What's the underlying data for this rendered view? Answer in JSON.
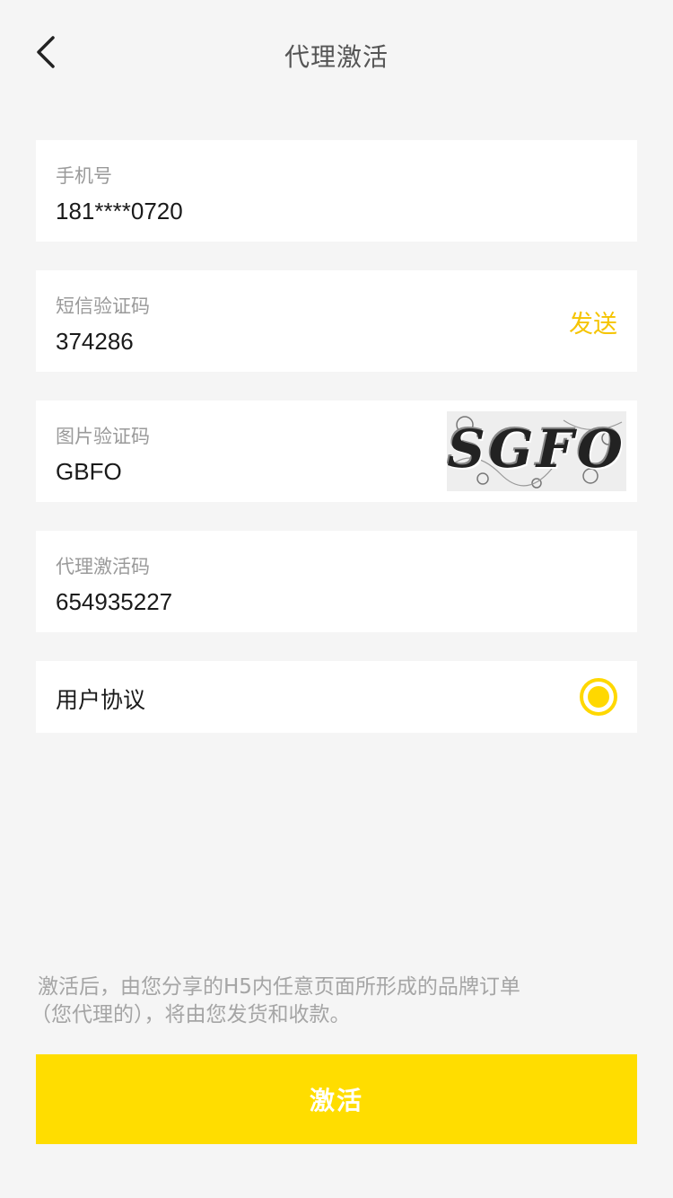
{
  "header": {
    "title": "代理激活",
    "back_icon": "chevron-left-icon"
  },
  "fields": {
    "phone": {
      "label": "手机号",
      "value": "181****0720"
    },
    "sms_code": {
      "label": "短信验证码",
      "value": "374286",
      "send_label": "发送"
    },
    "captcha": {
      "label": "图片验证码",
      "value": "GBFO",
      "image_text": "SGFO"
    },
    "activation_code": {
      "label": "代理激活码",
      "value": "654935227"
    }
  },
  "agreement": {
    "label": "用户协议",
    "checked": true
  },
  "notice": {
    "line1": "激活后，由您分享的H5内任意页面所形成的品牌订单",
    "line2": "（您代理的），将由您发货和收款。"
  },
  "actions": {
    "activate_label": "激活"
  },
  "colors": {
    "accent": "#ffdd00",
    "send_text": "#f5c400",
    "background": "#f5f5f5"
  }
}
